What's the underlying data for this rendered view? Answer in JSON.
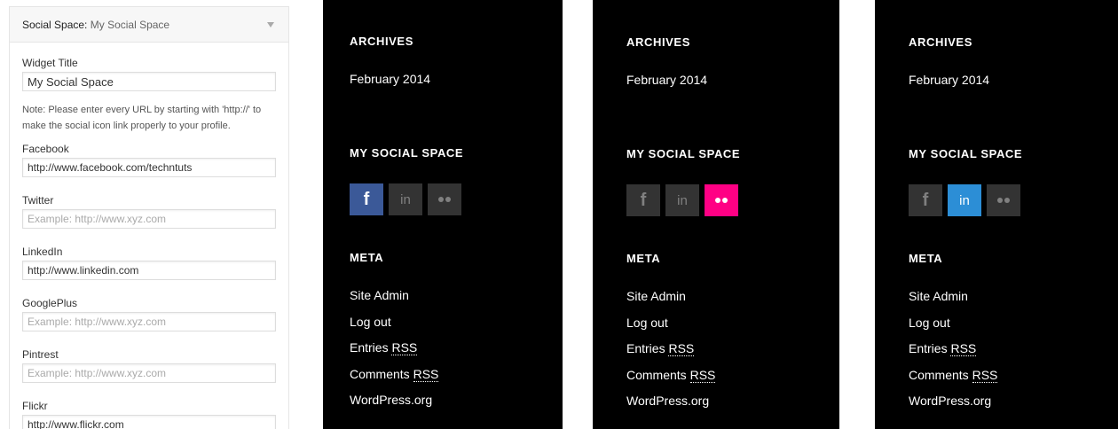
{
  "widget": {
    "title": "Social Space:",
    "subtitle": "My Social Space",
    "fields": {
      "widget_title": {
        "label": "Widget Title",
        "value": "My Social Space"
      },
      "note": "Note: Please enter every URL by starting with 'http://' to make the social icon link properly to your profile.",
      "facebook": {
        "label": "Facebook",
        "value": "http://www.facebook.com/techntuts",
        "placeholder": ""
      },
      "twitter": {
        "label": "Twitter",
        "value": "",
        "placeholder": "Example: http://www.xyz.com"
      },
      "linkedin": {
        "label": "LinkedIn",
        "value": "http://www.linkedin.com",
        "placeholder": ""
      },
      "googleplus": {
        "label": "GooglePlus",
        "value": "",
        "placeholder": "Example: http://www.xyz.com"
      },
      "pintrest": {
        "label": "Pintrest",
        "value": "",
        "placeholder": "Example: http://www.xyz.com"
      },
      "flickr": {
        "label": "Flickr",
        "value": "http://www.flickr.com",
        "placeholder": ""
      }
    }
  },
  "sidebar": {
    "archives_title": "ARCHIVES",
    "archive_link": "February 2014",
    "social_title": "MY SOCIAL SPACE",
    "icons": {
      "facebook": "f",
      "linkedin": "in"
    },
    "meta_title": "META",
    "meta_links": {
      "site_admin": "Site Admin",
      "log_out": "Log out",
      "entries": "Entries",
      "comments": "Comments",
      "rss": "RSS",
      "wordpress": "WordPress.org"
    }
  },
  "colors": {
    "facebook_active": "#3b5998",
    "linkedin_active": "#2c8ed6",
    "flickr_active": "#ff0084",
    "icon_inactive": "#333333"
  },
  "previews": [
    {
      "active": "facebook"
    },
    {
      "active": "flickr"
    },
    {
      "active": "linkedin"
    }
  ]
}
